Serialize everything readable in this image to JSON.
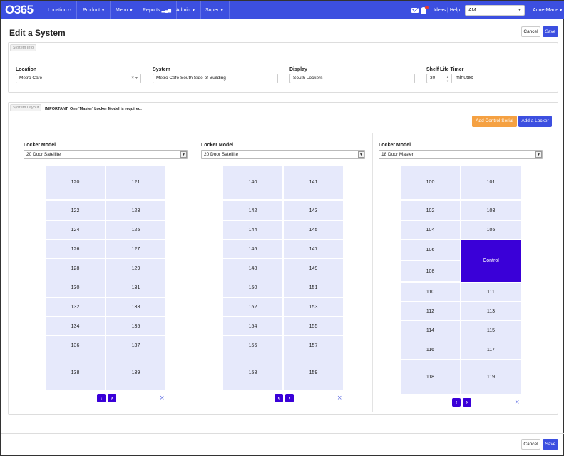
{
  "nav": {
    "logo": "O365",
    "items": [
      {
        "label": "Location",
        "icon": "home-icon"
      },
      {
        "label": "Product",
        "icon": "caret-down"
      },
      {
        "label": "Menu",
        "icon": "caret-down"
      },
      {
        "label": "Reports",
        "icon": "bar-chart-icon"
      },
      {
        "label": "Admin",
        "icon": "caret-down"
      },
      {
        "label": "Super",
        "icon": "caret-down"
      }
    ],
    "ideas_help": "Ideas | Help",
    "select_value": "AM",
    "user": "Anne-Marie"
  },
  "page": {
    "title": "Edit a System",
    "cancel": "Cancel",
    "save": "Save"
  },
  "system_info": {
    "tag": "System Info",
    "location_label": "Location",
    "location_value": "Metro Cafe",
    "system_label": "System",
    "system_value": "Metro Cafe South Side of Building",
    "display_label": "Display",
    "display_value": "South Lockers",
    "shelf_label": "Shelf Life Timer",
    "shelf_value": "30",
    "shelf_unit": "minutes"
  },
  "system_layout": {
    "tag": "System Layout",
    "important": "IMPORTANT: One 'Master' Locker Model is required.",
    "add_control_serial": "Add Control Serial",
    "add_locker": "Add a Locker",
    "model_label": "Locker Model"
  },
  "lockers": [
    {
      "model": "20 Door Satellite",
      "doors": [
        [
          "120",
          "121"
        ],
        [
          "122",
          "123"
        ],
        [
          "124",
          "125"
        ],
        [
          "126",
          "127"
        ],
        [
          "128",
          "129"
        ],
        [
          "130",
          "131"
        ],
        [
          "132",
          "133"
        ],
        [
          "134",
          "135"
        ],
        [
          "136",
          "137"
        ],
        [
          "138",
          "139"
        ]
      ]
    },
    {
      "model": "20 Door Satellite",
      "doors": [
        [
          "140",
          "141"
        ],
        [
          "142",
          "143"
        ],
        [
          "144",
          "145"
        ],
        [
          "146",
          "147"
        ],
        [
          "148",
          "149"
        ],
        [
          "150",
          "151"
        ],
        [
          "152",
          "153"
        ],
        [
          "154",
          "155"
        ],
        [
          "156",
          "157"
        ],
        [
          "158",
          "159"
        ]
      ]
    },
    {
      "model": "18 Door Master",
      "doors": [
        [
          "100",
          "101"
        ],
        [
          "102",
          "103"
        ],
        [
          "104",
          "105"
        ],
        [
          "106",
          "108"
        ],
        [
          "110",
          "111"
        ],
        [
          "112",
          "113"
        ],
        [
          "114",
          "115"
        ],
        [
          "116",
          "117"
        ],
        [
          "118",
          "119"
        ]
      ],
      "control": "Control"
    }
  ],
  "colors": {
    "nav": "#3c4fe0",
    "door": "#e6e9fb",
    "control": "#3a00d8",
    "orange": "#f5a142"
  }
}
